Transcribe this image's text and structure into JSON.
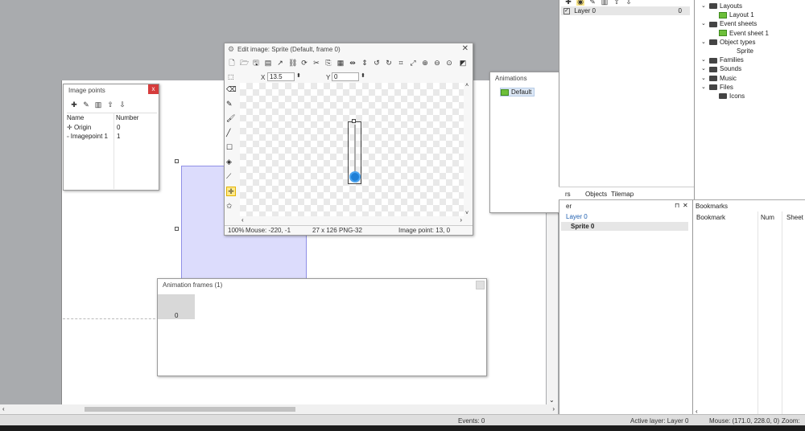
{
  "image_points": {
    "title": "Image points",
    "close": "x",
    "headers": [
      "Name",
      "Number"
    ],
    "rows": [
      {
        "name": "Origin",
        "number": "0"
      },
      {
        "name": "Imagepoint 1",
        "number": "1"
      }
    ]
  },
  "edit_image": {
    "title": "Edit image: Sprite (Default, frame 0)",
    "x_label": "X",
    "x_value": "13.5",
    "y_label": "Y",
    "y_value": "0",
    "status": {
      "zoom": "100%",
      "mouse": "Mouse: -220, -1",
      "size": "27 x 126",
      "format": "PNG-32",
      "imagepoint": "Image point: 13, 0"
    }
  },
  "animations": {
    "title": "Animations",
    "items": [
      "Default"
    ]
  },
  "animation_frames": {
    "title": "Animation frames (1)",
    "frames": [
      "0"
    ]
  },
  "layers": {
    "row": {
      "name": "Layer 0",
      "value": "0"
    }
  },
  "project_tree": {
    "items": [
      {
        "label": "Layouts",
        "indent": 1,
        "type": "folder"
      },
      {
        "label": "Layout 1",
        "indent": 2,
        "type": "layout"
      },
      {
        "label": "Event sheets",
        "indent": 1,
        "type": "folder"
      },
      {
        "label": "Event sheet 1",
        "indent": 2,
        "type": "layout"
      },
      {
        "label": "Object types",
        "indent": 1,
        "type": "folder"
      },
      {
        "label": "Sprite",
        "indent": 3,
        "type": "plain"
      },
      {
        "label": "Families",
        "indent": 1,
        "type": "folder"
      },
      {
        "label": "Sounds",
        "indent": 1,
        "type": "folder"
      },
      {
        "label": "Music",
        "indent": 1,
        "type": "folder"
      },
      {
        "label": "Files",
        "indent": 1,
        "type": "folder"
      },
      {
        "label": "Icons",
        "indent": 2,
        "type": "folder"
      }
    ]
  },
  "bottom_tabs": [
    "rs",
    "Objects",
    "Tilemap"
  ],
  "layer_panel": {
    "title": "er",
    "items": [
      "Layer 0",
      "Sprite 0"
    ]
  },
  "bookmarks": {
    "title": "Bookmarks",
    "headers": [
      "Bookmark",
      "Num",
      "Sheet"
    ]
  },
  "status_bar": {
    "events": "Events: 0",
    "active_layer": "Active layer: Layer 0",
    "mouse": "Mouse: (171.0, 228.0, 0)",
    "zoom": "Zoom: "
  }
}
